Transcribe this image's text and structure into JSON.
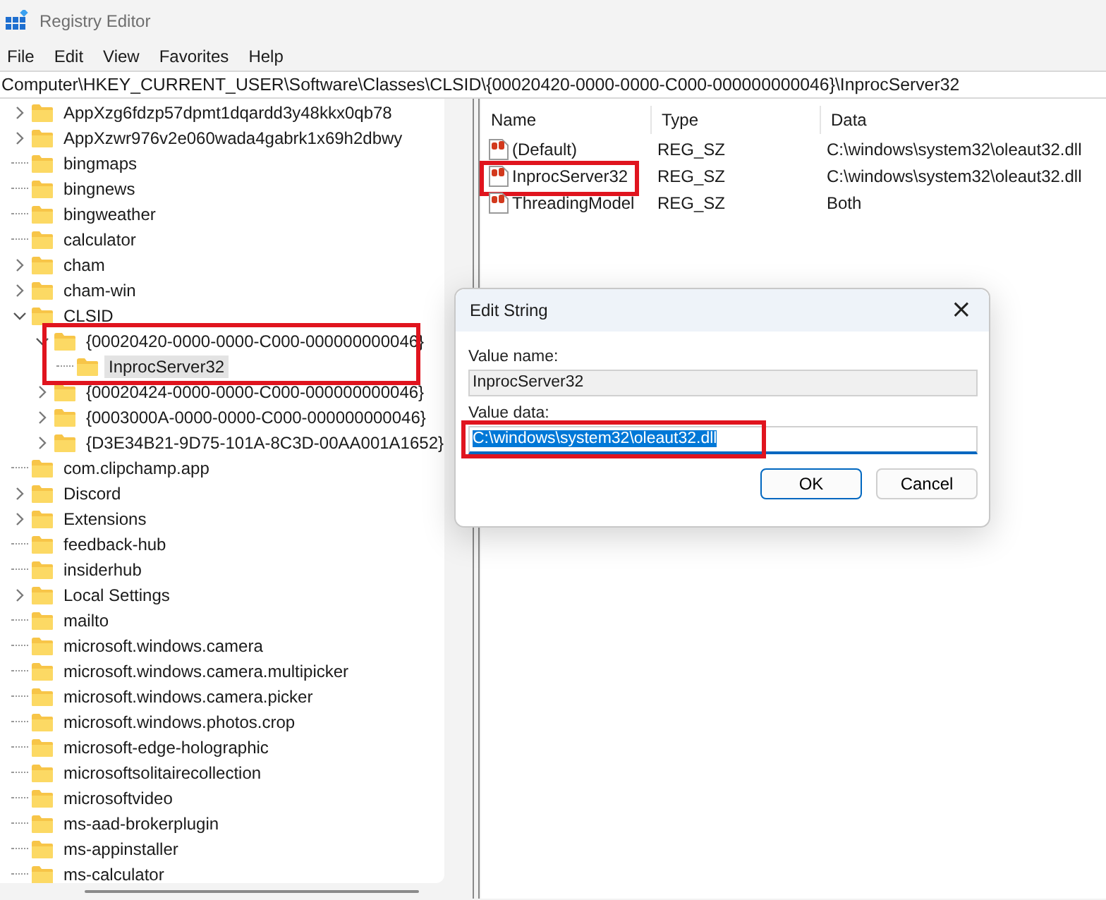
{
  "window": {
    "title": "Registry Editor"
  },
  "menu": [
    "File",
    "Edit",
    "View",
    "Favorites",
    "Help"
  ],
  "address": "Computer\\HKEY_CURRENT_USER\\Software\\Classes\\CLSID\\{00020420-0000-0000-C000-000000000046}\\InprocServer32",
  "tree": {
    "items": [
      {
        "name": "AppXzg6fdzp57dpmt1dqardd3y48kkx0qb78",
        "expandable": true,
        "expanded": false,
        "selected": false,
        "highlighted": false
      },
      {
        "name": "AppXzwr976v2e060wada4gabrk1x69h2dbwy",
        "expandable": true,
        "expanded": false,
        "selected": false,
        "highlighted": false
      },
      {
        "name": "bingmaps",
        "expandable": false,
        "selected": false,
        "highlighted": false
      },
      {
        "name": "bingnews",
        "expandable": false,
        "selected": false,
        "highlighted": false
      },
      {
        "name": "bingweather",
        "expandable": false,
        "selected": false,
        "highlighted": false
      },
      {
        "name": "calculator",
        "expandable": false,
        "selected": false,
        "highlighted": false
      },
      {
        "name": "cham",
        "expandable": true,
        "expanded": false,
        "selected": false,
        "highlighted": false
      },
      {
        "name": "cham-win",
        "expandable": true,
        "expanded": false,
        "selected": false,
        "highlighted": false
      },
      {
        "name": "CLSID",
        "expandable": true,
        "expanded": true,
        "selected": false,
        "highlighted": false,
        "children": [
          {
            "name": "{00020420-0000-0000-C000-000000000046}",
            "expandable": true,
            "expanded": true,
            "selected": false,
            "highlighted": true,
            "children": [
              {
                "name": "InprocServer32",
                "expandable": false,
                "selected": true,
                "highlighted": false
              }
            ]
          },
          {
            "name": "{00020424-0000-0000-C000-000000000046}",
            "expandable": true,
            "expanded": false,
            "selected": false,
            "highlighted": false
          },
          {
            "name": "{0003000A-0000-0000-C000-000000000046}",
            "expandable": true,
            "expanded": false,
            "selected": false,
            "highlighted": false
          },
          {
            "name": "{D3E34B21-9D75-101A-8C3D-00AA001A1652}",
            "expandable": true,
            "expanded": false,
            "selected": false,
            "highlighted": false
          }
        ]
      },
      {
        "name": "com.clipchamp.app",
        "expandable": false,
        "selected": false,
        "highlighted": false
      },
      {
        "name": "Discord",
        "expandable": true,
        "expanded": false,
        "selected": false,
        "highlighted": false
      },
      {
        "name": "Extensions",
        "expandable": true,
        "expanded": false,
        "selected": false,
        "highlighted": false
      },
      {
        "name": "feedback-hub",
        "expandable": false,
        "selected": false,
        "highlighted": false
      },
      {
        "name": "insiderhub",
        "expandable": false,
        "selected": false,
        "highlighted": false
      },
      {
        "name": "Local Settings",
        "expandable": true,
        "expanded": false,
        "selected": false,
        "highlighted": false
      },
      {
        "name": "mailto",
        "expandable": false,
        "selected": false,
        "highlighted": false
      },
      {
        "name": "microsoft.windows.camera",
        "expandable": false,
        "selected": false,
        "highlighted": false
      },
      {
        "name": "microsoft.windows.camera.multipicker",
        "expandable": false,
        "selected": false,
        "highlighted": false
      },
      {
        "name": "microsoft.windows.camera.picker",
        "expandable": false,
        "selected": false,
        "highlighted": false
      },
      {
        "name": "microsoft.windows.photos.crop",
        "expandable": false,
        "selected": false,
        "highlighted": false
      },
      {
        "name": "microsoft-edge-holographic",
        "expandable": false,
        "selected": false,
        "highlighted": false
      },
      {
        "name": "microsoftsolitairecollection",
        "expandable": false,
        "selected": false,
        "highlighted": false
      },
      {
        "name": "microsoftvideo",
        "expandable": false,
        "selected": false,
        "highlighted": false
      },
      {
        "name": "ms-aad-brokerplugin",
        "expandable": false,
        "selected": false,
        "highlighted": false
      },
      {
        "name": "ms-appinstaller",
        "expandable": false,
        "selected": false,
        "highlighted": false
      },
      {
        "name": "ms-calculator",
        "expandable": false,
        "selected": false,
        "highlighted": false
      }
    ]
  },
  "values": {
    "columns": [
      "Name",
      "Type",
      "Data"
    ],
    "rows": [
      {
        "name": "(Default)",
        "type": "REG_SZ",
        "data": "C:\\windows\\system32\\oleaut32.dll",
        "highlighted": false
      },
      {
        "name": "InprocServer32",
        "type": "REG_SZ",
        "data": "C:\\windows\\system32\\oleaut32.dll",
        "highlighted": true
      },
      {
        "name": "ThreadingModel",
        "type": "REG_SZ",
        "data": "Both",
        "highlighted": false
      }
    ]
  },
  "dialog": {
    "title": "Edit String",
    "close": "×",
    "fields": [
      {
        "label": "Value name:",
        "value": "InprocServer32",
        "kind": "readonly",
        "text_selected": false,
        "highlighted": false
      },
      {
        "label": "Value data:",
        "value": "C:\\windows\\system32\\oleaut32.dll",
        "kind": "editable",
        "text_selected": true,
        "highlighted": true
      }
    ],
    "buttons": [
      {
        "label": "OK",
        "default": true
      },
      {
        "label": "Cancel",
        "default": false
      }
    ]
  }
}
